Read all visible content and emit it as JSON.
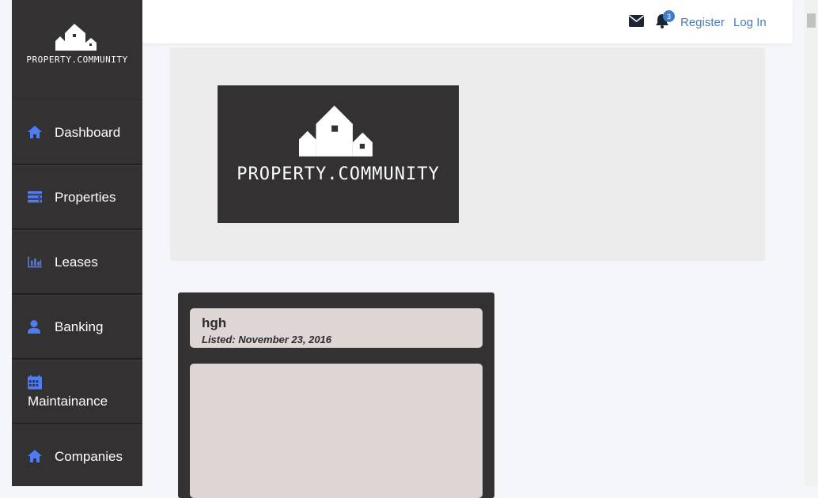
{
  "brand": {
    "name": "PROPERTY.COMMUNITY"
  },
  "sidebar": {
    "items": [
      {
        "label": "Dashboard",
        "icon": "home-icon"
      },
      {
        "label": "Properties",
        "icon": "server-icon"
      },
      {
        "label": "Leases",
        "icon": "bar-chart-icon"
      },
      {
        "label": "Banking",
        "icon": "user-icon"
      },
      {
        "label": "Maintainance",
        "icon": "calendar-icon"
      },
      {
        "label": "Companies",
        "icon": "home-icon"
      }
    ]
  },
  "topbar": {
    "notification_count": "3",
    "register_label": "Register",
    "login_label": "Log In"
  },
  "listing": {
    "title": "hgh",
    "listed": "Listed: November 23, 2016"
  },
  "colors": {
    "sidebar_bg": "#333132",
    "accent": "#4d7cf4",
    "link": "#4a7bb3"
  }
}
